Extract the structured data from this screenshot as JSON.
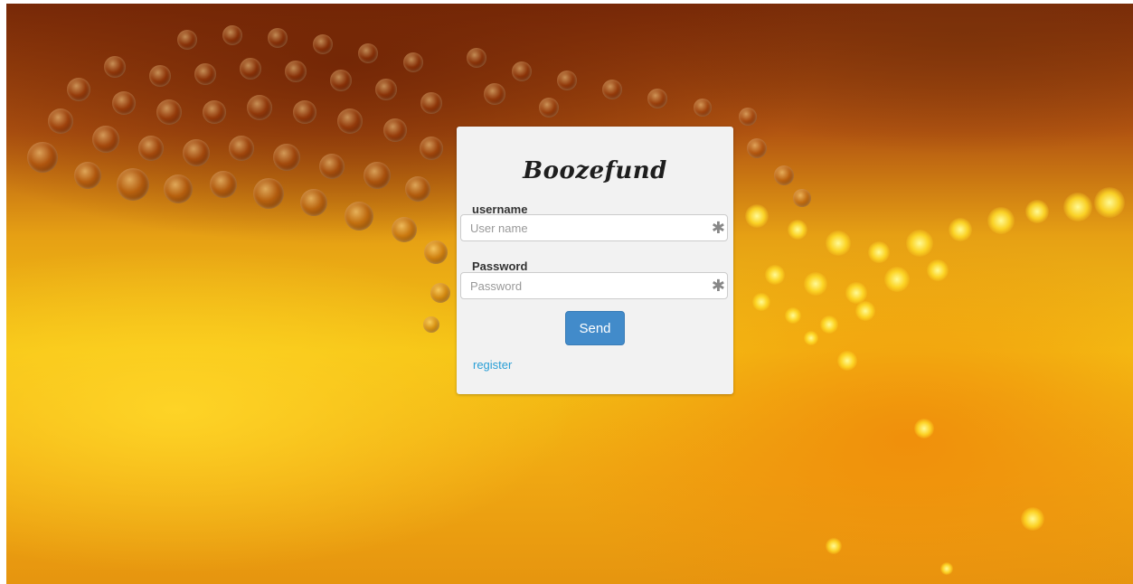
{
  "app": {
    "title": "Boozefund"
  },
  "login": {
    "username_label": "username",
    "username_placeholder": "User name",
    "password_label": "Password",
    "password_placeholder": "Password",
    "required_marker": "✱",
    "send_label": "Send",
    "register_link": "register"
  },
  "colors": {
    "primary_button": "#428bca",
    "link": "#2a9fd6",
    "card_background": "#f2f2f2"
  }
}
